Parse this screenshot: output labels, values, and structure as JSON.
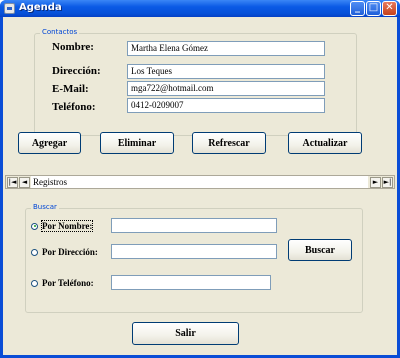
{
  "window": {
    "title": "Agenda"
  },
  "contactos": {
    "legend": "Contactos",
    "nombre_label": "Nombre:",
    "nombre_value": "Martha Elena Gómez",
    "direccion_label": "Dirección:",
    "direccion_value": "Los Teques",
    "email_label": "E-Mail:",
    "email_value": "mga722@hotmail.com",
    "telefono_label": "Teléfono:",
    "telefono_value": "0412-0209007"
  },
  "actions": {
    "agregar": "Agregar",
    "eliminar": "Eliminar",
    "refrescar": "Refrescar",
    "actualizar": "Actualizar"
  },
  "navigator": {
    "first": "|◄",
    "prev": "◄",
    "caption": "Registros",
    "next": "►",
    "last": "►|"
  },
  "buscar": {
    "legend": "Buscar",
    "por_nombre": "Por Nombre:",
    "por_direccion": "Por Dirección:",
    "por_telefono": "Por Teléfono:",
    "selected": "por_nombre",
    "nombre_value": "",
    "direccion_value": "",
    "telefono_value": "",
    "button": "Buscar"
  },
  "footer": {
    "salir": "Salir"
  }
}
